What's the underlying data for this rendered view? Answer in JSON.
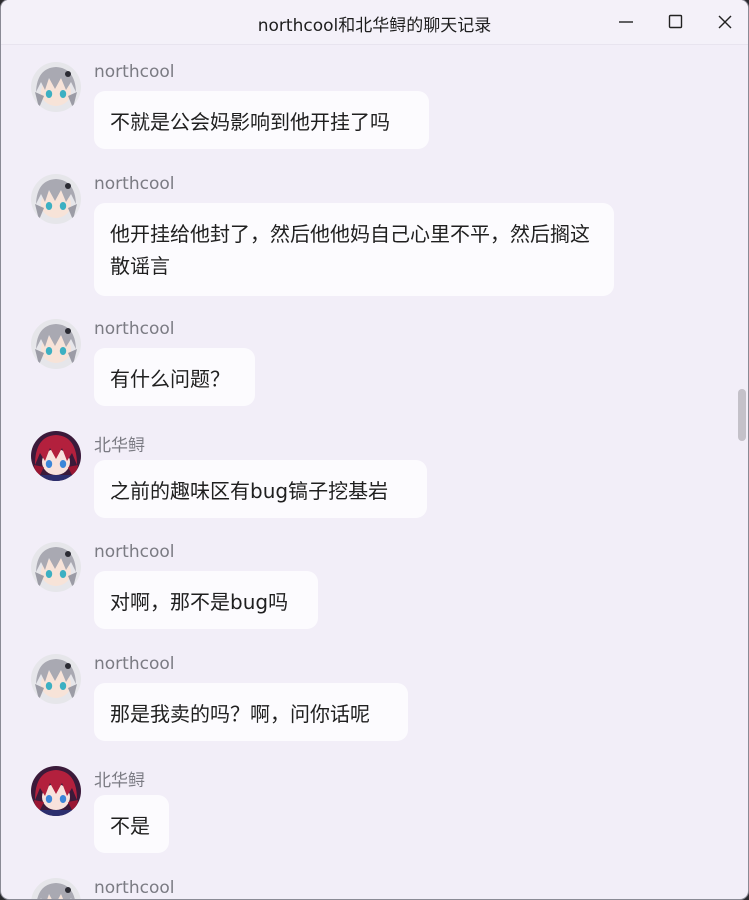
{
  "window": {
    "title": "northcool和北华鲟的聊天记录"
  },
  "messages": [
    {
      "sender": "northcool",
      "text": "不就是公会妈影响到他开挂了吗",
      "avatar_icon": "gray-hair-anime-avatar-icon"
    },
    {
      "sender": "northcool",
      "text": "他开挂给他封了，然后他他妈自己心里不平，然后搁这散谣言",
      "avatar_icon": "gray-hair-anime-avatar-icon"
    },
    {
      "sender": "northcool",
      "text": "有什么问题？",
      "avatar_icon": "gray-hair-anime-avatar-icon"
    },
    {
      "sender": "北华鲟",
      "text": "之前的趣味区有bug镐子挖基岩",
      "avatar_icon": "red-hair-anime-avatar-icon"
    },
    {
      "sender": "northcool",
      "text": "对啊，那不是bug吗",
      "avatar_icon": "gray-hair-anime-avatar-icon"
    },
    {
      "sender": "northcool",
      "text": "那是我卖的吗？啊，问你话呢",
      "avatar_icon": "gray-hair-anime-avatar-icon"
    },
    {
      "sender": "北华鲟",
      "text": "不是",
      "avatar_icon": "red-hair-anime-avatar-icon"
    },
    {
      "sender": "northcool",
      "text": "",
      "avatar_icon": "gray-hair-anime-avatar-icon"
    }
  ],
  "colors": {
    "background": "#f2eef8",
    "bubble": "#fcfbfe",
    "sender_text": "#7b7b83",
    "message_text": "#1f1f1f"
  }
}
